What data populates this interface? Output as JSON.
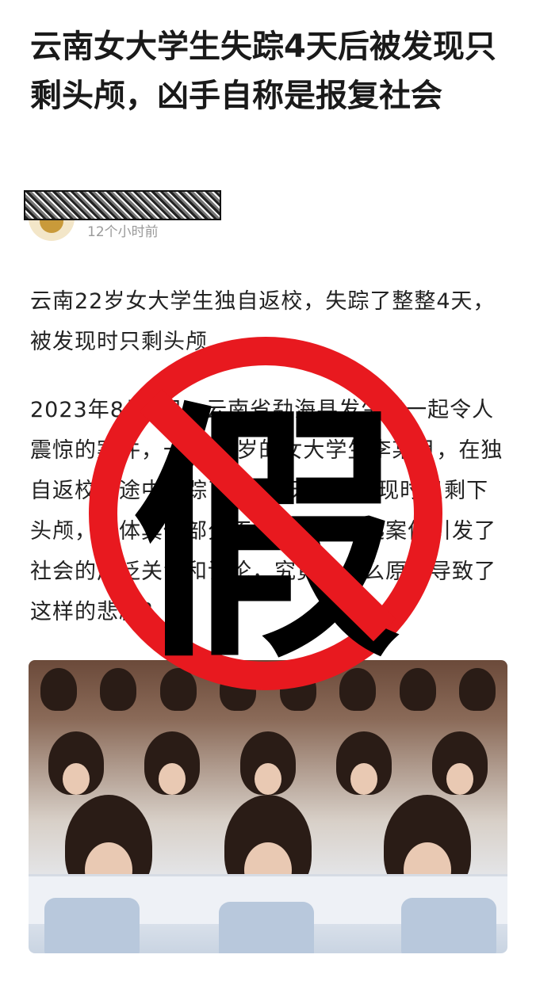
{
  "article": {
    "title": "云南女大学生失踪4天后被发现只剩头颅，凶手自称是报复社会",
    "author": {
      "time": "12个小时前",
      "avatar_icon": "avatar-icon"
    },
    "paragraphs": [
      "云南22岁女大学生独自返校，失踪了整整4天，被发现时只剩头颅",
      "2023年8月4日，云南省勐海县发生了一起令人震惊的案件，一名22岁的女大学生李某月，在独自返校的途中失踪了整整4天，被发现时只剩下头颅，身体其他部分不知所踪。这起案件引发了社会的广泛关注和讨论，究竟是什么原因导致了这样的悲剧？"
    ],
    "photo": {
      "name": "classroom-students-photo"
    }
  },
  "stamp": {
    "char": "假",
    "color": "#e8191f"
  }
}
